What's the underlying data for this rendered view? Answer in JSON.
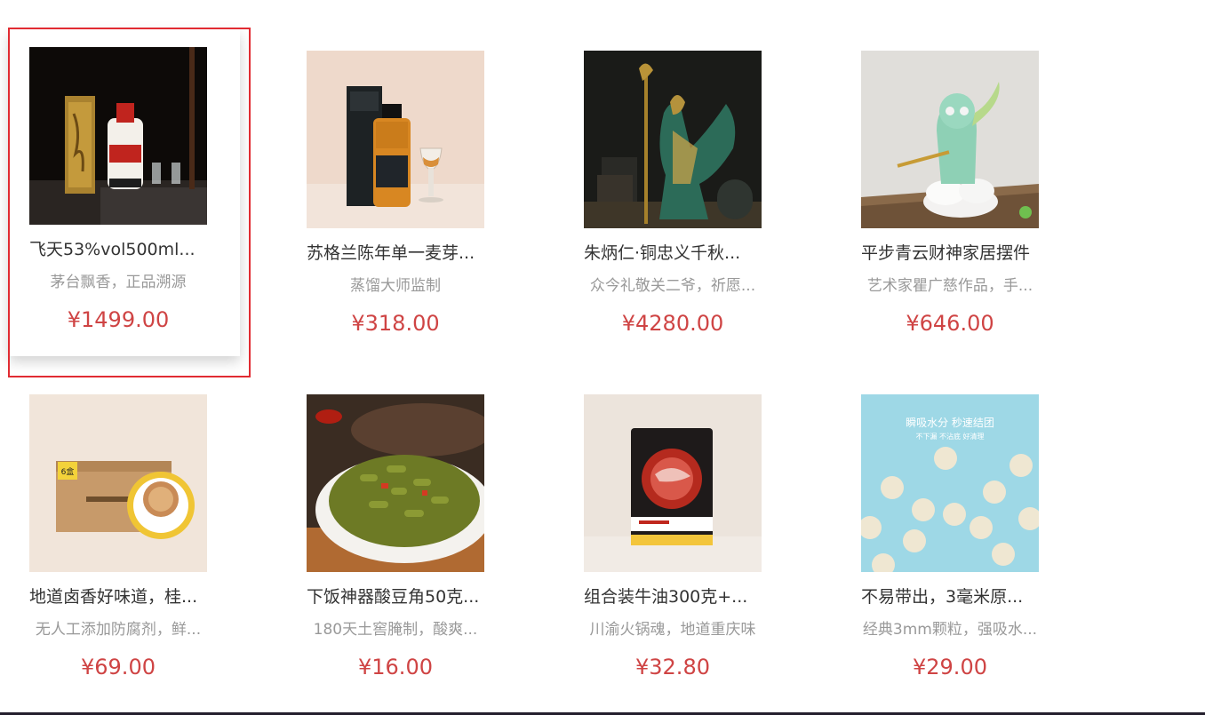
{
  "products": [
    {
      "name": "飞天53%vol500ml...",
      "desc": "茅台飘香，正品溯源",
      "price": "¥1499.00",
      "image": "moutai-liquor-image"
    },
    {
      "name": "苏格兰陈年单一麦芽...",
      "desc": "蒸馏大师监制",
      "price": "¥318.00",
      "image": "scotch-whisky-image"
    },
    {
      "name": "朱炳仁·铜忠义千秋...",
      "desc": "众今礼敬关二爷，祈愿...",
      "price": "¥4280.00",
      "image": "bronze-statue-image"
    },
    {
      "name": "平步青云财神家居摆件",
      "desc": "艺术家瞿广慈作品，手...",
      "price": "¥646.00",
      "image": "figurine-ornament-image"
    },
    {
      "name": "地道卤香好味道，桂...",
      "desc": "无人工添加防腐剂，鲜...",
      "price": "¥69.00",
      "image": "rice-noodle-box-image"
    },
    {
      "name": "下饭神器酸豆角50克...",
      "desc": "180天土窖腌制，酸爽...",
      "price": "¥16.00",
      "image": "pickled-beans-image"
    },
    {
      "name": "组合装牛油300克+...",
      "desc": "川渝火锅魂，地道重庆味",
      "price": "¥32.80",
      "image": "hotpot-base-image"
    },
    {
      "name": "不易带出，3毫米原...",
      "desc": "经典3mm颗粒，强吸水...",
      "price": "¥29.00",
      "image": "cat-litter-image",
      "image_text": "瞬吸水分 秒速结团",
      "image_subtext": "不下漏 不沾底 好清理"
    }
  ],
  "colors": {
    "price": "#cf4444",
    "highlight_border": "#e12b32"
  }
}
